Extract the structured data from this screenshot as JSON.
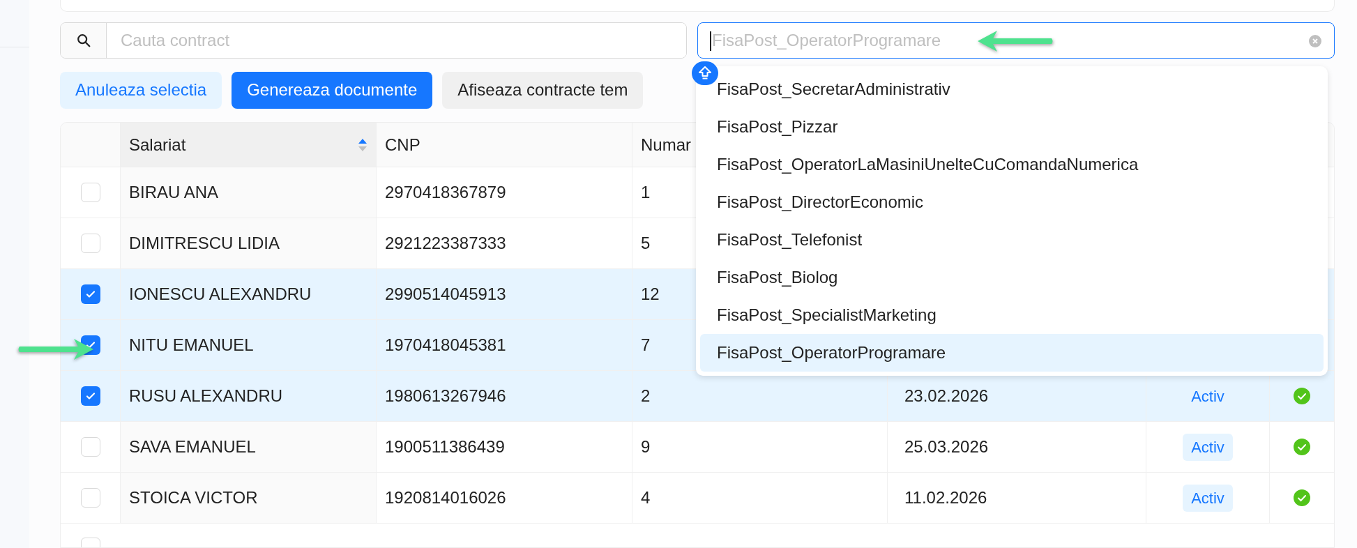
{
  "search": {
    "placeholder": "Cauta contract"
  },
  "select": {
    "placeholder": "FisaPost_OperatorProgramare"
  },
  "buttons": [
    {
      "label": "Anuleaza selectia",
      "kind": "light"
    },
    {
      "label": "Genereaza documente",
      "kind": "primary"
    },
    {
      "label": "Afiseaza contracte tem",
      "kind": "default"
    }
  ],
  "table": {
    "columns": [
      "Salariat",
      "CNP",
      "Numar"
    ],
    "rows": [
      {
        "checked": false,
        "salariat": "BIRAU ANA",
        "cnp": "2970418367879",
        "numar": "1"
      },
      {
        "checked": false,
        "salariat": "DIMITRESCU LIDIA",
        "cnp": "2921223387333",
        "numar": "5"
      },
      {
        "checked": true,
        "salariat": "IONESCU ALEXANDRU",
        "cnp": "2990514045913",
        "numar": "12"
      },
      {
        "checked": true,
        "salariat": "NITU EMANUEL",
        "cnp": "1970418045381",
        "numar": "7"
      },
      {
        "checked": true,
        "salariat": "RUSU ALEXANDRU",
        "cnp": "1980613267946",
        "numar": "2",
        "date": "23.02.2026",
        "status": "Activ",
        "confirmed": true
      },
      {
        "checked": false,
        "salariat": "SAVA EMANUEL",
        "cnp": "1900511386439",
        "numar": "9",
        "date": "25.03.2026",
        "status": "Activ",
        "confirmed": true
      },
      {
        "checked": false,
        "salariat": "STOICA VICTOR",
        "cnp": "1920814016026",
        "numar": "4",
        "date": "11.02.2026",
        "status": "Activ",
        "confirmed": true
      }
    ]
  },
  "dropdown": {
    "options": [
      {
        "label": "FisaPost_SecretarAdministrativ",
        "selected": false
      },
      {
        "label": "FisaPost_Pizzar",
        "selected": false
      },
      {
        "label": "FisaPost_OperatorLaMasiniUnelteCuComandaNumerica",
        "selected": false
      },
      {
        "label": "FisaPost_DirectorEconomic",
        "selected": false
      },
      {
        "label": "FisaPost_Telefonist",
        "selected": false
      },
      {
        "label": "FisaPost_Biolog",
        "selected": false
      },
      {
        "label": "FisaPost_SpecialistMarketing",
        "selected": false
      },
      {
        "label": "FisaPost_OperatorProgramare",
        "selected": true
      }
    ]
  }
}
